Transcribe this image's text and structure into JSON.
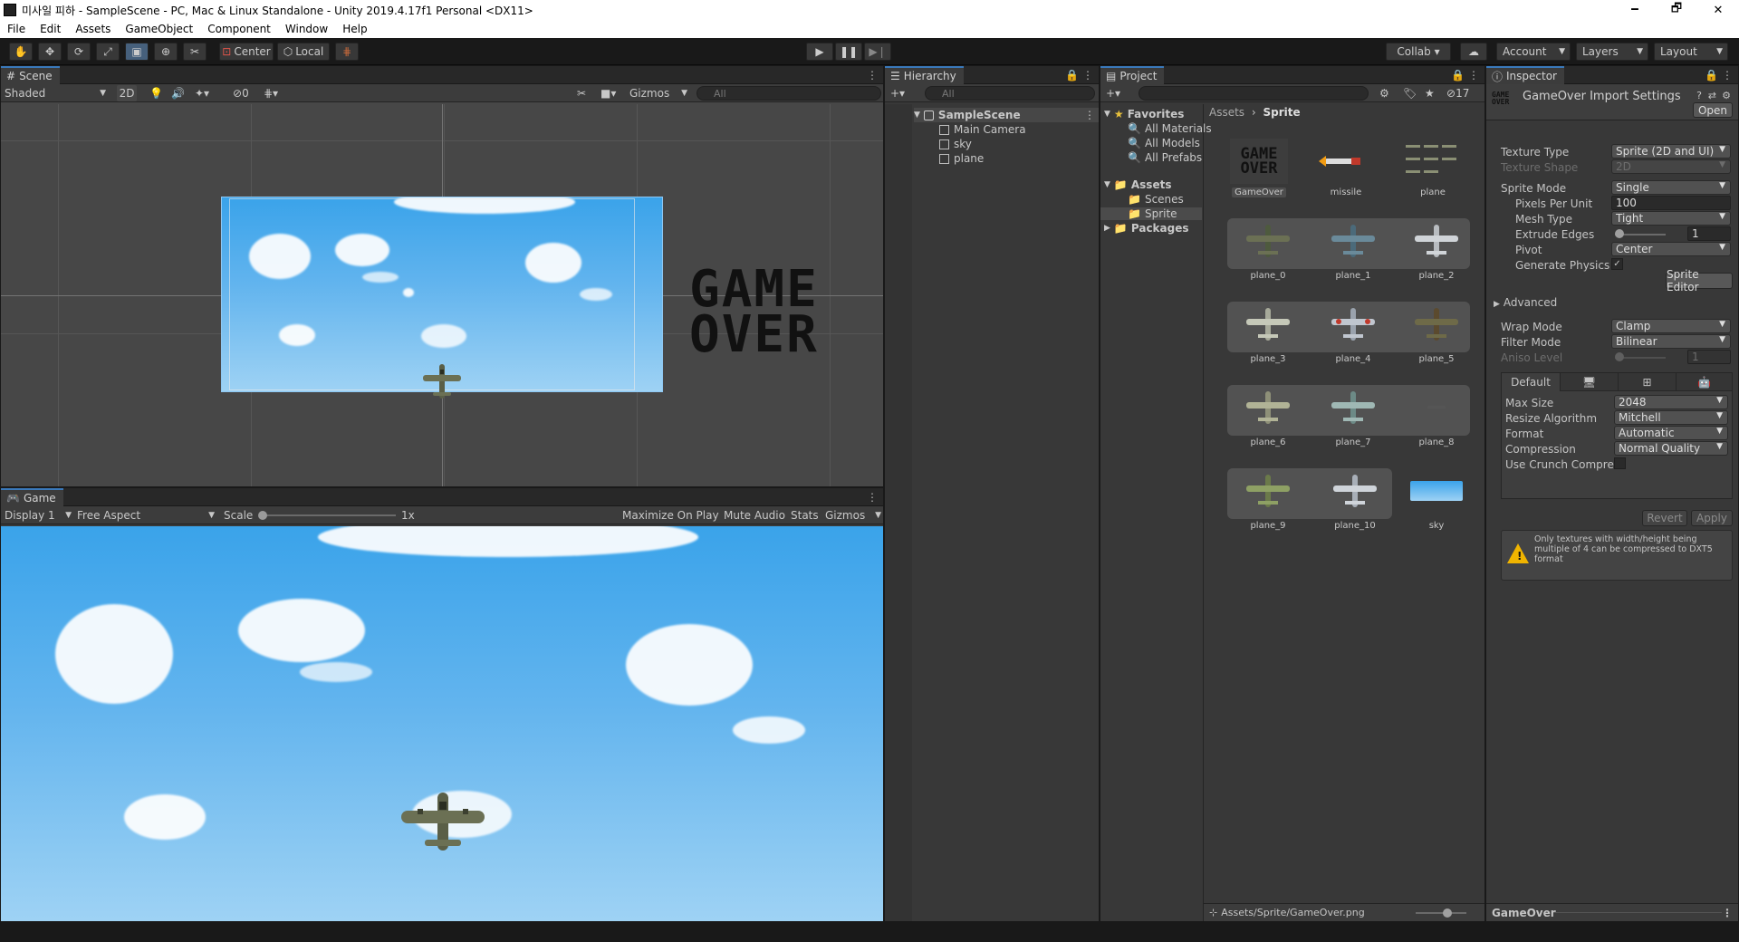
{
  "window": {
    "title": "미사일 피하 - SampleScene - PC, Mac & Linux Standalone - Unity 2019.4.17f1 Personal <DX11>",
    "minimize": "🗕",
    "maximize": "🗗",
    "close": "✕"
  },
  "menu": [
    "File",
    "Edit",
    "Assets",
    "GameObject",
    "Component",
    "Window",
    "Help"
  ],
  "toolbar": {
    "pivot": "Center",
    "space": "Local",
    "collab": "Collab ▾",
    "account": "Account",
    "layers": "Layers",
    "layout": "Layout"
  },
  "scene": {
    "tab": "Scene",
    "shading": "Shaded",
    "mode2d": "2D",
    "hidden_count": "0",
    "gizmos": "Gizmos",
    "search_placeholder": "All",
    "gameover_text": [
      "GAME",
      "OVER"
    ]
  },
  "game": {
    "tab": "Game",
    "display": "Display 1",
    "aspect": "Free Aspect",
    "scale_label": "Scale",
    "scale_value": "1x",
    "maximize": "Maximize On Play",
    "mute": "Mute Audio",
    "stats": "Stats",
    "gizmos": "Gizmos"
  },
  "hierarchy": {
    "tab": "Hierarchy",
    "search_placeholder": "All",
    "scene": "SampleScene",
    "items": [
      "Main Camera",
      "sky",
      "plane"
    ]
  },
  "project": {
    "tab": "Project",
    "hidden_count": "17",
    "favorites": "Favorites",
    "fav_items": [
      "All Materials",
      "All Models",
      "All Prefabs"
    ],
    "assets": "Assets",
    "asset_folders": [
      "Scenes",
      "Sprite"
    ],
    "packages": "Packages",
    "breadcrumb": [
      "Assets",
      "Sprite"
    ],
    "footer": "Assets/Sprite/GameOver.png",
    "thumbs": [
      "GameOver",
      "missile",
      "plane",
      "plane_0",
      "plane_1",
      "plane_2",
      "plane_3",
      "plane_4",
      "plane_5",
      "plane_6",
      "plane_7",
      "plane_8",
      "plane_9",
      "plane_10",
      "sky"
    ]
  },
  "inspector": {
    "tab": "Inspector",
    "title": "GameOver Import Settings",
    "open": "Open",
    "texture_type_label": "Texture Type",
    "texture_type": "Sprite (2D and UI)",
    "texture_shape_label": "Texture Shape",
    "texture_shape": "2D",
    "sprite_mode_label": "Sprite Mode",
    "sprite_mode": "Single",
    "ppu_label": "Pixels Per Unit",
    "ppu": "100",
    "mesh_type_label": "Mesh Type",
    "mesh_type": "Tight",
    "extrude_label": "Extrude Edges",
    "extrude": "1",
    "pivot_label": "Pivot",
    "pivot": "Center",
    "gen_physics_label": "Generate Physics S",
    "gen_physics_check": "✓",
    "sprite_editor": "Sprite Editor",
    "advanced": "Advanced",
    "wrap_label": "Wrap Mode",
    "wrap": "Clamp",
    "filter_label": "Filter Mode",
    "filter": "Bilinear",
    "aniso_label": "Aniso Level",
    "aniso": "1",
    "platform_default": "Default",
    "max_size_label": "Max Size",
    "max_size": "2048",
    "resize_label": "Resize Algorithm",
    "resize": "Mitchell",
    "format_label": "Format",
    "format": "Automatic",
    "compression_label": "Compression",
    "compression": "Normal Quality",
    "crunch_label": "Use Crunch Compres",
    "revert": "Revert",
    "apply": "Apply",
    "warning": "Only textures with width/height being multiple of 4 can be compressed to DXT5 format",
    "footer": "GameOver"
  },
  "colors": {
    "accent": "#3a79bb",
    "panel": "#383838",
    "sky_top": "#3aa3ea",
    "sky_bottom": "#9ed2f4"
  }
}
